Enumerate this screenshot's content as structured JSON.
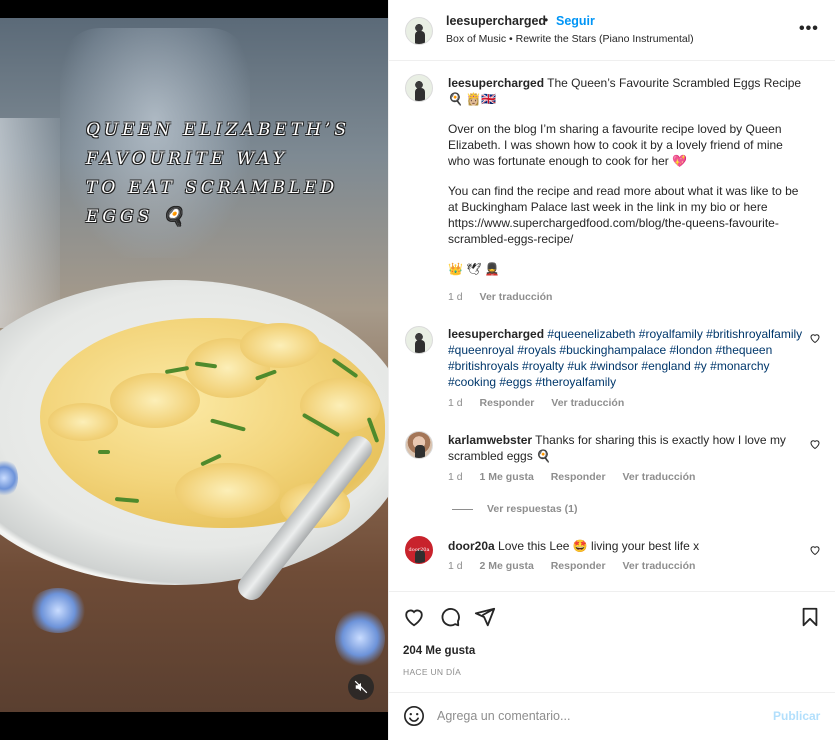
{
  "media": {
    "overlay_lines": [
      "QUEEN ELIZABETH’S",
      "FAVOURITE WAY",
      "TO EAT SCRAMBLED",
      "EGGS 🍳"
    ],
    "mute_icon": "speaker-muted-icon"
  },
  "header": {
    "username": "leesupercharged",
    "separator": "•",
    "follow_label": "Seguir",
    "audio": "Box of Music • Rewrite the Stars (Piano Instrumental)",
    "more_label": "•••"
  },
  "caption": {
    "username": "leesupercharged",
    "title": "The Queen’s Favourite Scrambled Eggs Recipe",
    "emoji_line": "🍳 👸🏼🇬🇧",
    "paragraph1": "Over on the blog I’m sharing a favourite recipe loved by Queen Elizabeth. I was shown how to cook it by a lovely friend of mine who was fortunate enough to cook for her 💖",
    "paragraph2": "You can find the recipe and read more about what it was like to be at Buckingham Palace last week in the link in my bio or here https://www.superchargedfood.com/blog/the-queens-favourite-scrambled-eggs-recipe/",
    "emojis_end": "👑 🕊 💂",
    "time": "1 d",
    "translate": "Ver traducción"
  },
  "comments": [
    {
      "username": "leesupercharged",
      "text": "#queenelizabeth #royalfamily #britishroyalfamily #queenroyal #royals #buckinghampalace #london #thequeen #britishroyals #royalty #uk #windsor #england #y #monarchy #cooking #eggs #theroyalfamily",
      "time": "1 d",
      "reply": "Responder",
      "translate": "Ver traducción"
    },
    {
      "username": "karlamwebster",
      "text": "Thanks for sharing this is exactly how I love my scrambled eggs 🍳",
      "time": "1 d",
      "likes": "1 Me gusta",
      "reply": "Responder",
      "translate": "Ver traducción",
      "view_replies": "Ver respuestas (1)"
    },
    {
      "username": "door20a",
      "avatar_text": "door20a",
      "text": "Love this Lee 🤩 living your best life x",
      "time": "1 d",
      "likes": "2 Me gusta",
      "reply": "Responder",
      "translate": "Ver traducción"
    }
  ],
  "actions": {
    "likes_count": "204 Me gusta",
    "time_ago": "HACE UN DÍA"
  },
  "add_comment": {
    "placeholder": "Agrega un comentario...",
    "publish": "Publicar"
  },
  "colors": {
    "accent": "#0095f6",
    "hashtag": "#00376b",
    "muted": "#8e8e8e",
    "publish_disabled": "#b2dffc"
  }
}
